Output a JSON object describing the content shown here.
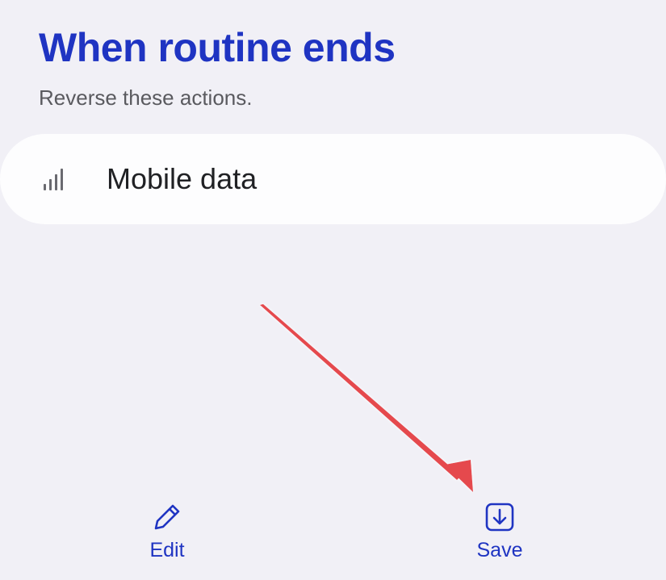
{
  "header": {
    "title": "When routine ends",
    "subtitle": "Reverse these actions."
  },
  "actions": [
    {
      "label": "Mobile data",
      "icon": "signal-bars-icon"
    }
  ],
  "bottom_bar": {
    "edit_label": "Edit",
    "save_label": "Save"
  },
  "colors": {
    "accent": "#1f34c2",
    "background": "#f1f0f6",
    "card": "#fdfdfe",
    "annotation_arrow": "#e5484d"
  }
}
